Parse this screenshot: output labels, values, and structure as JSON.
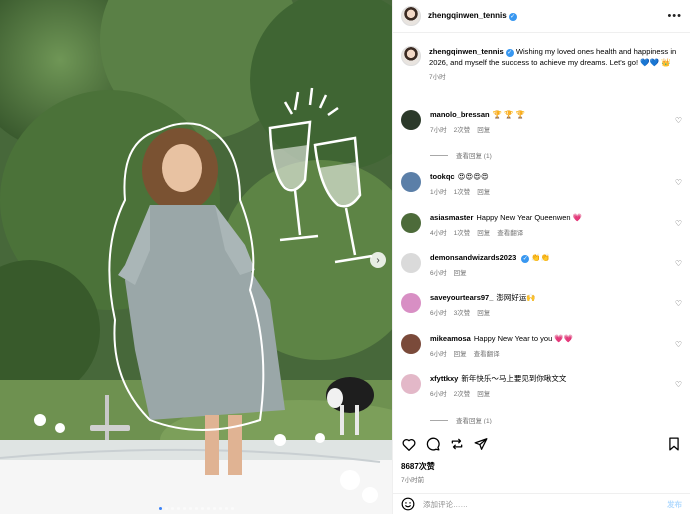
{
  "post": {
    "owner": "zhengqinwen_tennis",
    "more_icon": "more-horizontal-icon",
    "caption": {
      "username": "zhengqinwen_tennis",
      "text": "Wishing my loved ones health and happiness in 2026, and myself the success to achieve my dreams. Let's go! 💙💙 👑",
      "time": "7小时"
    },
    "comments": [
      {
        "username": "manolo_bressan",
        "text": "🏆 🏆 🏆",
        "time": "7小时",
        "likes": "2次赞",
        "reply": "回复",
        "view_replies": "查看回复 (1)",
        "avatar_color": "#2c3a2a"
      },
      {
        "username": "tookqc",
        "text": "😍😍😍😍",
        "time": "1小时",
        "likes": "1次赞",
        "reply": "回复",
        "avatar_color": "#5b7fa8"
      },
      {
        "username": "asiasmaster",
        "text": "Happy New Year Queenwen 💗",
        "time": "4小时",
        "likes": "1次赞",
        "reply": "回复",
        "translate": "查看翻译",
        "avatar_color": "#4d6b3a"
      },
      {
        "username": "demonsandwizards2023",
        "text": "👏👏",
        "verified": true,
        "time": "6小时",
        "reply": "回复",
        "avatar_color": "#dadada"
      },
      {
        "username": "saveyourtears97_",
        "text": "澎网好运🙌",
        "time": "6小时",
        "likes": "3次赞",
        "reply": "回复",
        "avatar_color": "#d88fc4"
      },
      {
        "username": "mikeamosa",
        "text": "Happy New Year to you 💗💗",
        "time": "6小时",
        "reply": "回复",
        "translate": "查看翻译",
        "avatar_color": "#7a4a3a"
      },
      {
        "username": "xfyttkxy",
        "text": "新年快乐～马上要见到你啾文文",
        "time": "6小时",
        "likes": "2次赞",
        "reply": "回复",
        "view_replies": "查看回复 (1)",
        "avatar_color": "#e3b8c8"
      }
    ],
    "likes": "8687次赞",
    "time": "7小时前",
    "comment_placeholder": "添加评论……",
    "post_label": "发布"
  },
  "colors": {
    "verified": "#3897f0",
    "heart_red": "#ed4956",
    "link_blue": "#b3dbff"
  },
  "carousel": {
    "total": 13,
    "active": 1
  }
}
